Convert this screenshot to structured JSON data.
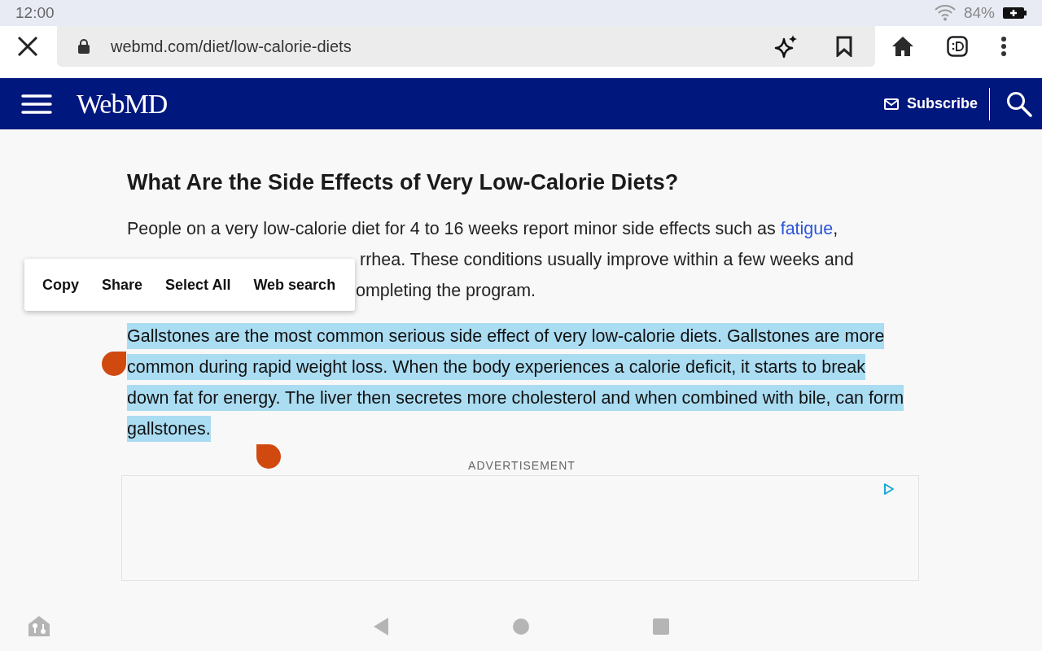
{
  "status_bar": {
    "time": "12:00",
    "battery": "84%"
  },
  "browser": {
    "url": "webmd.com/diet/low-calorie-diets"
  },
  "site_header": {
    "logo": "WebMD",
    "subscribe": "Subscribe"
  },
  "article": {
    "heading": "What Are the Side Effects of Very Low-Calorie Diets?",
    "intro": {
      "before_link": "People on a very low-calorie diet for 4 to 16 weeks report minor side effects such as ",
      "link": "fatigue",
      "after_link": ",",
      "line_2_visible": "rrhea. These conditions usually improve within a few weeks and",
      "line_3_visible": "ompleting the program."
    },
    "paragraph": {
      "text": "Gallstones are the most common serious side effect of very low-calorie diets. Gallstones are more common during rapid weight loss. When the body experiences a calorie deficit, it starts to break down fat for energy. The liver then secretes more cholesterol and when combined with bile, can form gallstones.",
      "selected": true
    }
  },
  "text_menu": [
    "Copy",
    "Share",
    "Select All",
    "Web search"
  ],
  "ad": {
    "label": "ADVERTISEMENT"
  }
}
